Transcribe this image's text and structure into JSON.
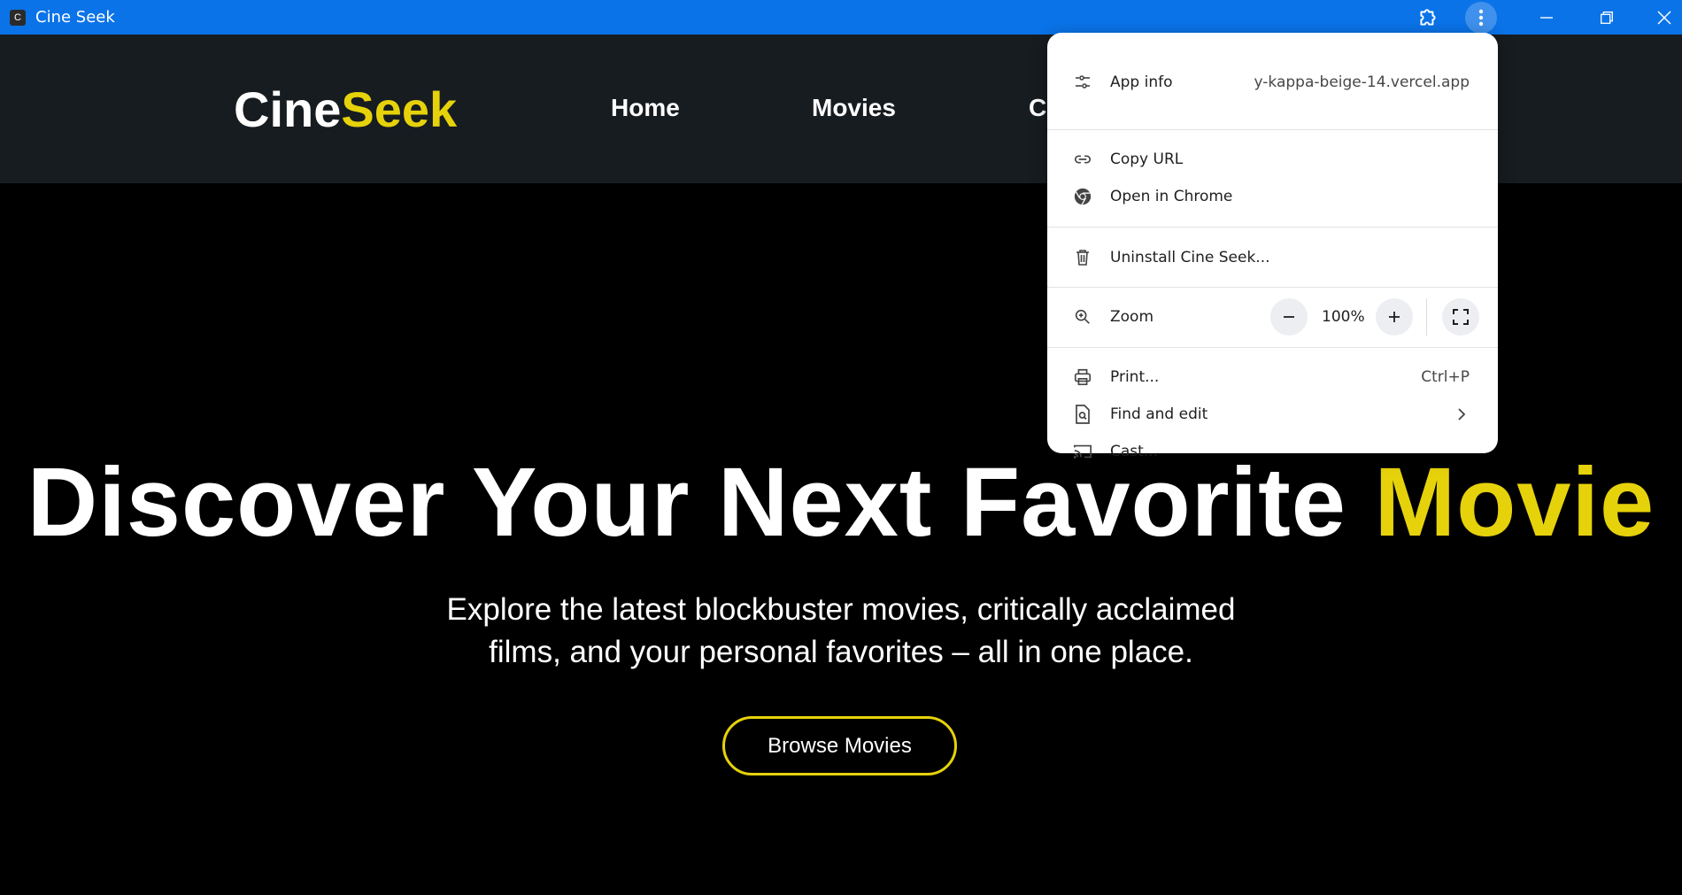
{
  "window": {
    "app_icon_letter": "C",
    "title": "Cine Seek",
    "titlebar_color": "#0a73e8",
    "icons": [
      "extension-icon",
      "kebab-menu-icon",
      "minimize-icon",
      "restore-icon",
      "close-icon"
    ]
  },
  "site": {
    "logo_primary": "Cine",
    "logo_accent": "Seek",
    "accent_color": "#e6d20a",
    "nav": [
      "Home",
      "Movies",
      "C"
    ]
  },
  "hero": {
    "title_primary": "Discover Your Next Favorite",
    "title_accent": "Movie",
    "subtitle_line1": "Explore the latest blockbuster movies, critically acclaimed",
    "subtitle_line2": "films, and your personal favorites – all in one place.",
    "cta_label": "Browse Movies"
  },
  "menu": {
    "app_info_label": "App info",
    "app_info_url": "y-kappa-beige-14.vercel.app",
    "copy_url_label": "Copy URL",
    "open_in_chrome_label": "Open in Chrome",
    "uninstall_label": "Uninstall Cine Seek...",
    "zoom_label": "Zoom",
    "zoom_value": "100%",
    "print_label": "Print...",
    "print_shortcut": "Ctrl+P",
    "find_edit_label": "Find and edit",
    "cast_label": "Cast..."
  }
}
